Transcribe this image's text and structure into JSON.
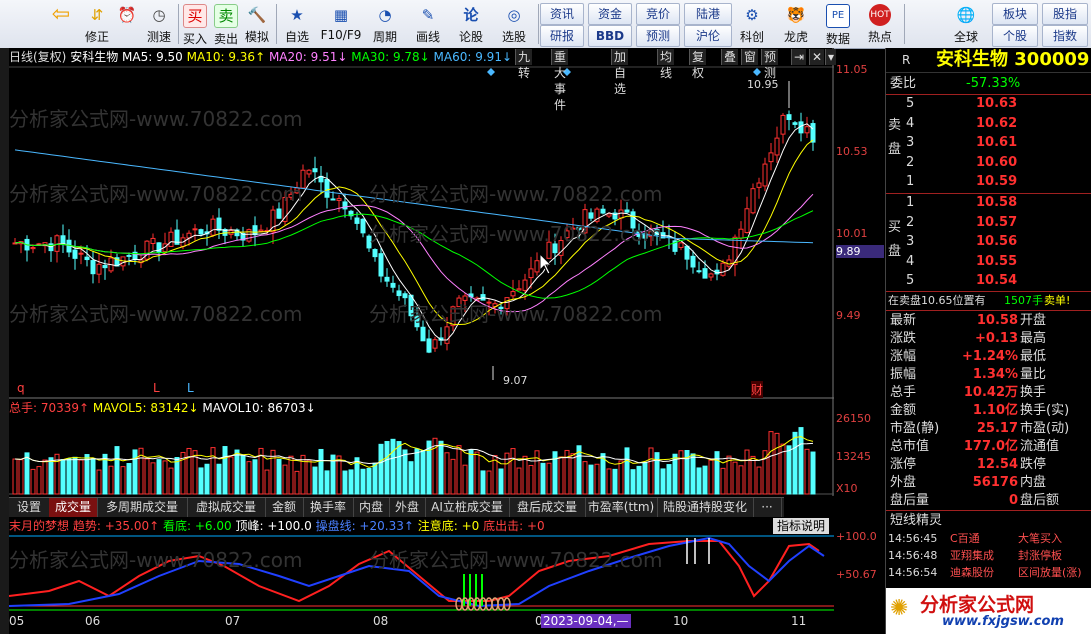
{
  "toolbar": {
    "buttons": [
      {
        "label": "",
        "icon": "back-icon"
      },
      {
        "label": "修正",
        "icon": "updown-icon"
      },
      {
        "label": "",
        "icon": "alarm-icon"
      },
      {
        "label": "测速",
        "icon": "speed-icon"
      },
      {
        "label": "买入",
        "icon": "buy-icon",
        "glyph": "买"
      },
      {
        "label": "卖出",
        "icon": "sell-icon",
        "glyph": "卖"
      },
      {
        "label": "模拟",
        "icon": "hammer-icon"
      },
      {
        "label": "自选",
        "icon": "star-icon"
      },
      {
        "label": "F10/F9",
        "icon": "f10-icon"
      },
      {
        "label": "周期",
        "icon": "clock-icon"
      },
      {
        "label": "画线",
        "icon": "pen-icon"
      },
      {
        "label": "论股",
        "icon": "forum-icon",
        "glyph": "论"
      },
      {
        "label": "选股",
        "icon": "select-icon"
      }
    ],
    "small": [
      "资讯",
      "资金",
      "竞价",
      "陆港",
      "研报",
      "BBD",
      "预测",
      "沪伦"
    ],
    "big": [
      {
        "label": "科创",
        "icon": "kc-icon"
      },
      {
        "label": "龙虎",
        "icon": "tiger-icon"
      },
      {
        "label": "数据",
        "icon": "pe-icon",
        "glyph": "PE"
      },
      {
        "label": "热点",
        "icon": "hot-icon",
        "glyph": "HOT"
      },
      {
        "label": "全球",
        "icon": "globe-icon"
      }
    ],
    "right_small": [
      "板块",
      "股指",
      "个股",
      "指数"
    ]
  },
  "chart_info": {
    "period": "日线(复权)",
    "stock": "安科生物",
    "ma5": "MA5: 9.50",
    "ma10": "MA10: 9.36↑",
    "ma20": "MA20: 9.51↓",
    "ma30": "MA30: 9.78↓",
    "ma60": "MA60: 9.91↓"
  },
  "chart_buttons": [
    "九转",
    "重大事件",
    "加自选",
    "均线",
    "复权",
    "叠",
    "窗",
    "预测"
  ],
  "watermark": "分析家公式网-www.70822.com",
  "price_axis": [
    "11.05",
    "10.53",
    "10.01",
    "9.89",
    "9.49"
  ],
  "annotations": {
    "high": "10.95",
    "low": "9.07",
    "fin_marker": "财"
  },
  "event_markers": [
    "q",
    "L",
    "L"
  ],
  "volume_info": {
    "total": "总手: 70339↑",
    "mavol5": "MAVOL5: 83142↓",
    "mavol10": "MAVOL10: 86703↓"
  },
  "volume_axis": [
    "26150",
    "13245",
    "X10"
  ],
  "sub_tabs": [
    "设置",
    "成交量",
    "多周期成交量",
    "虚拟成交量",
    "金额",
    "换手率",
    "内盘",
    "外盘",
    "AI立桩成交量",
    "盘后成交量",
    "市盈率(ttm)",
    "陆股通持股变化",
    "···"
  ],
  "indicator": {
    "name": "末月的梦想",
    "trend": "趋势: +35.00↑",
    "bottom": "看底: +6.00",
    "top": "顶峰: +100.0",
    "watch": "操盘线: +20.33↑",
    "note": "注意底: +0",
    "out": "底出击: +0",
    "help": "指标说明",
    "axis_top": "+100.0",
    "axis_mid": "+50.67"
  },
  "dates": [
    "05",
    "06",
    "07",
    "08",
    "0",
    "10",
    "11"
  ],
  "date_highlight": "2023-09-04,—",
  "quote": {
    "code_flag": "R",
    "name": "安科生物 300009",
    "weibi_label": "委比",
    "weibi": "-57.33%",
    "sell_label": [
      "卖",
      "盘"
    ],
    "buy_label": [
      "买",
      "盘"
    ],
    "sell": [
      {
        "lvl": "5",
        "price": "10.63"
      },
      {
        "lvl": "4",
        "price": "10.62"
      },
      {
        "lvl": "3",
        "price": "10.61"
      },
      {
        "lvl": "2",
        "price": "10.60"
      },
      {
        "lvl": "1",
        "price": "10.59"
      }
    ],
    "buy": [
      {
        "lvl": "1",
        "price": "10.58"
      },
      {
        "lvl": "2",
        "price": "10.57"
      },
      {
        "lvl": "3",
        "price": "10.56"
      },
      {
        "lvl": "4",
        "price": "10.55"
      },
      {
        "lvl": "5",
        "price": "10.54"
      }
    ],
    "sell_notice": "在卖盘10.65位置有",
    "sell_notice_qty": "1507手",
    "sell_notice_tag": "卖单!",
    "stats": [
      {
        "l": "最新",
        "v": "10.58",
        "r": "开盘"
      },
      {
        "l": "涨跌",
        "v": "+0.13",
        "r": "最高"
      },
      {
        "l": "涨幅",
        "v": "+1.24%",
        "r": "最低"
      },
      {
        "l": "振幅",
        "v": "1.34%",
        "r": "量比"
      },
      {
        "l": "总手",
        "v": "10.42万",
        "r": "换手"
      },
      {
        "l": "金额",
        "v": "1.10亿",
        "r": "换手(实)"
      },
      {
        "l": "市盈(静)",
        "v": "25.17",
        "r": "市盈(动)"
      },
      {
        "l": "总市值",
        "v": "177.0亿",
        "r": "流通值"
      },
      {
        "l": "涨停",
        "v": "12.54",
        "r": "跌停"
      },
      {
        "l": "外盘",
        "v": "56176",
        "r": "内盘"
      },
      {
        "l": "盘后量",
        "v": "0",
        "r": "盘后额"
      }
    ],
    "sprite_title": "短线精灵",
    "sprites": [
      {
        "t": "14:56:45",
        "n": "C百通",
        "e": "大笔买入"
      },
      {
        "t": "14:56:48",
        "n": "亚翔集成",
        "e": "封涨停板"
      },
      {
        "t": "14:56:54",
        "n": "迪森股份",
        "e": "区间放量(涨)"
      }
    ],
    "logo_text": "分析家公式网",
    "logo_url": "www.fxjgsw.com"
  },
  "colors": {
    "up": "#ff3030",
    "down": "#54ffff",
    "ma5": "#ffffff",
    "ma10": "#ffff00",
    "ma20": "#ff80ff",
    "ma30": "#00ff00",
    "ma60": "#4ab8ff"
  }
}
